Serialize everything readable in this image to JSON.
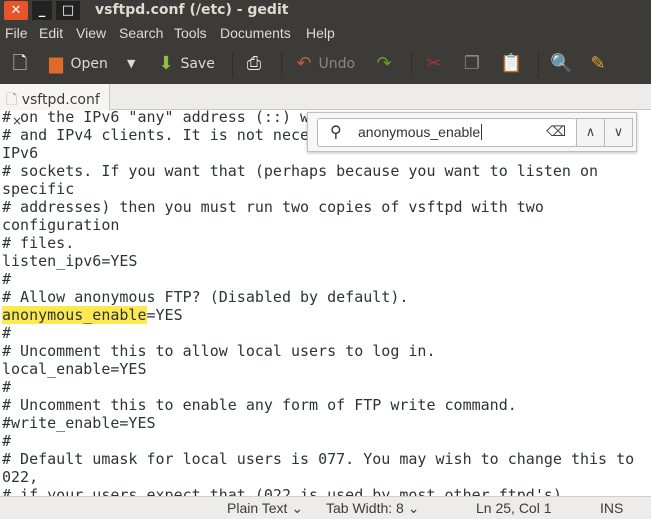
{
  "window": {
    "title": "vsftpd.conf (/etc) - gedit",
    "close": "✕",
    "minimize": "_",
    "maximize": "□"
  },
  "menu": [
    "File",
    "Edit",
    "View",
    "Search",
    "Tools",
    "Documents",
    "Help"
  ],
  "toolbar": {
    "open": "Open",
    "save": "Save",
    "undo": "Undo"
  },
  "tab": {
    "label": "vsftpd.conf",
    "close": "×"
  },
  "search": {
    "value": "anonymous_enable"
  },
  "editor": {
    "lines": [
      "# on the IPv6 \"any\" address (::) w",
      "# and IPv4 clients. It is not nece",
      "IPv6",
      "# sockets. If you want that (perhaps because you want to listen on",
      "specific",
      "# addresses) then you must run two copies of vsftpd with two",
      "configuration",
      "# files.",
      "listen_ipv6=YES",
      "#",
      "# Allow anonymous FTP? (Disabled by default).",
      "",
      "#",
      "# Uncomment this to allow local users to log in.",
      "local_enable=YES",
      "#",
      "# Uncomment this to enable any form of FTP write command.",
      "#write_enable=YES",
      "#",
      "# Default umask for local users is 077. You may wish to change this to",
      "022,",
      "# if your users expect that (022 is used by most other ftpd's)"
    ],
    "match": "anonymous_enable",
    "match_rest": "=YES"
  },
  "status": {
    "language": "Plain Text ⌄",
    "tab_width": "Tab Width: 8 ⌄",
    "position": "Ln 25, Col 1",
    "mode": "INS"
  }
}
